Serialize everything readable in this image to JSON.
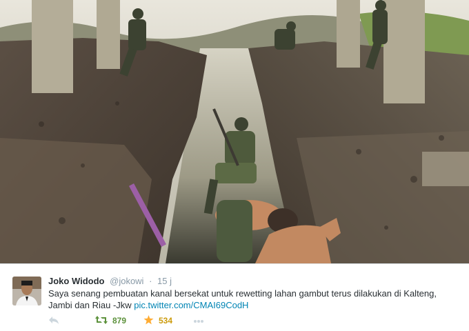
{
  "tweet": {
    "author_name": "Joko Widodo",
    "author_handle": "@jokowi",
    "separator": "·",
    "timestamp": "15 j",
    "text": "Saya senang pembuatan kanal bersekat untuk rewetting lahan gambut terus dilakukan di Kalteng, Jambi dan Riau -Jkw",
    "link": "pic.twitter.com/CMAI69CodH"
  },
  "actions": {
    "reply_icon": "reply-icon",
    "retweet_icon": "retweet-icon",
    "retweet_count": "879",
    "favorite_icon": "star-icon",
    "favorite_count": "534",
    "more_icon": "more-icon"
  },
  "colors": {
    "retweet": "#5c913b",
    "favorite": "#cc9b0c",
    "link": "#0084b4",
    "muted": "#8899a6",
    "text": "#292f33"
  }
}
